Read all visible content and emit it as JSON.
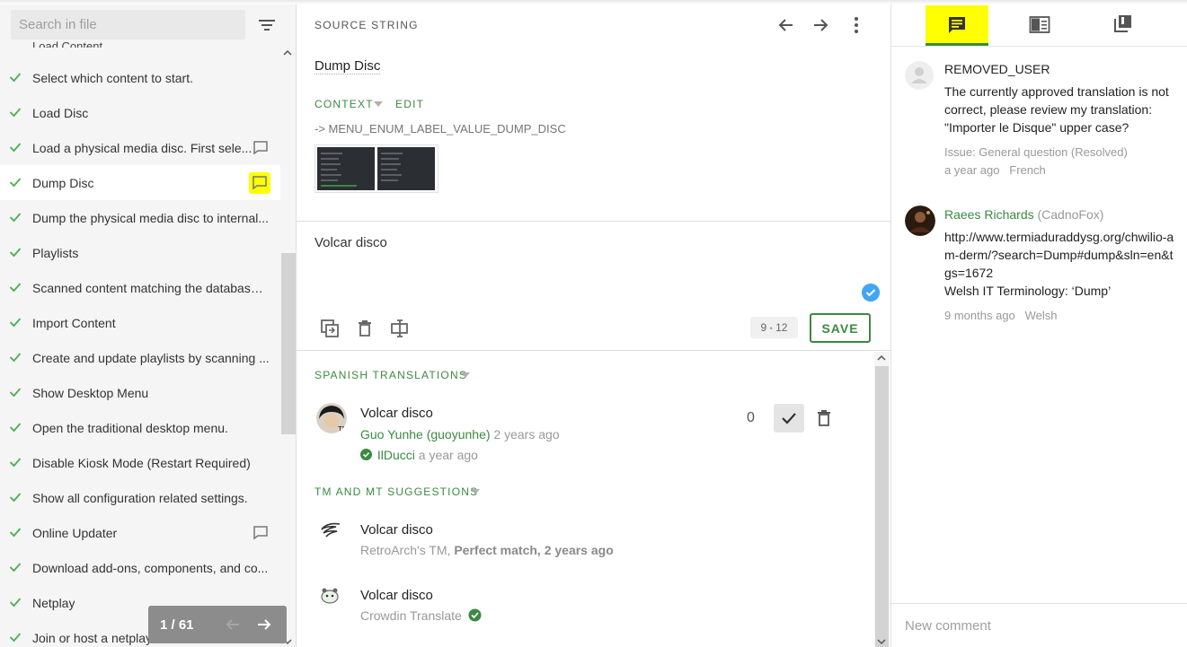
{
  "sidebar": {
    "search_placeholder": "Search in file",
    "partial_item": "Load Content",
    "items": [
      {
        "label": "Select which content to start."
      },
      {
        "label": "Load Disc"
      },
      {
        "label": "Load a physical media disc. First sele..."
      },
      {
        "label": "Dump Disc"
      },
      {
        "label": "Dump the physical media disc to internal..."
      },
      {
        "label": "Playlists"
      },
      {
        "label": "Scanned content matching the database ..."
      },
      {
        "label": "Import Content"
      },
      {
        "label": "Create and update playlists by scanning ..."
      },
      {
        "label": "Show Desktop Menu"
      },
      {
        "label": "Open the traditional desktop menu."
      },
      {
        "label": "Disable Kiosk Mode (Restart Required)"
      },
      {
        "label": "Show all configuration related settings."
      },
      {
        "label": "Online Updater"
      },
      {
        "label": "Download add-ons, components, and co..."
      },
      {
        "label": "Netplay"
      },
      {
        "label": "Join or host a netplay session."
      }
    ],
    "pager": "1 / 61"
  },
  "source": {
    "section_label": "SOURCE STRING",
    "text": "Dump Disc",
    "context_label": "CONTEXT",
    "edit_label": "EDIT",
    "context_key": "-> MENU_ENUM_LABEL_VALUE_DUMP_DISC"
  },
  "editor": {
    "translation": "Volcar disco",
    "counter_current": "9",
    "counter_sep": "•",
    "counter_max": "12",
    "save_label": "SAVE"
  },
  "translations": {
    "section_label": "SPANISH TRANSLATIONS",
    "items": [
      {
        "text": "Volcar disco",
        "author": "Guo Yunhe (guoyunhe)",
        "author_time": "2 years ago",
        "approver": "IlDucci",
        "approver_time": "a year ago",
        "votes": "0"
      }
    ]
  },
  "suggestions": {
    "section_label": "TM AND MT SUGGESTIONS",
    "items": [
      {
        "text": "Volcar disco",
        "source": "RetroArch's TM,",
        "detail": "Perfect match, 2 years ago"
      },
      {
        "text": "Volcar disco",
        "source": "Crowdin Translate"
      }
    ]
  },
  "comments": {
    "items": [
      {
        "user": "REMOVED_USER",
        "body": "The currently approved translation is not correct, please review my translation: \"Importer le Disque\" upper case?",
        "issue": "Issue: General question (Resolved)",
        "time": "a year ago",
        "lang": "French"
      },
      {
        "user": "Raees Richards",
        "handle": "(CadnoFox)",
        "link": "http://www.termiaduraddysg.org/chwilio-am-derm/?search=Dump#dump&sln=en&tgs=1672",
        "body": "Welsh IT Terminology: ‘Dump’",
        "time": "9 months ago",
        "lang": "Welsh"
      }
    ],
    "new_comment_placeholder": "New comment"
  },
  "colors": {
    "accent_green": "#3a8a3f",
    "highlight_yellow": "#ffff00",
    "check_blue": "#42a5f5"
  },
  "icons": {
    "tabs": [
      "comments-icon",
      "glossary-icon",
      "tm-icon"
    ]
  }
}
